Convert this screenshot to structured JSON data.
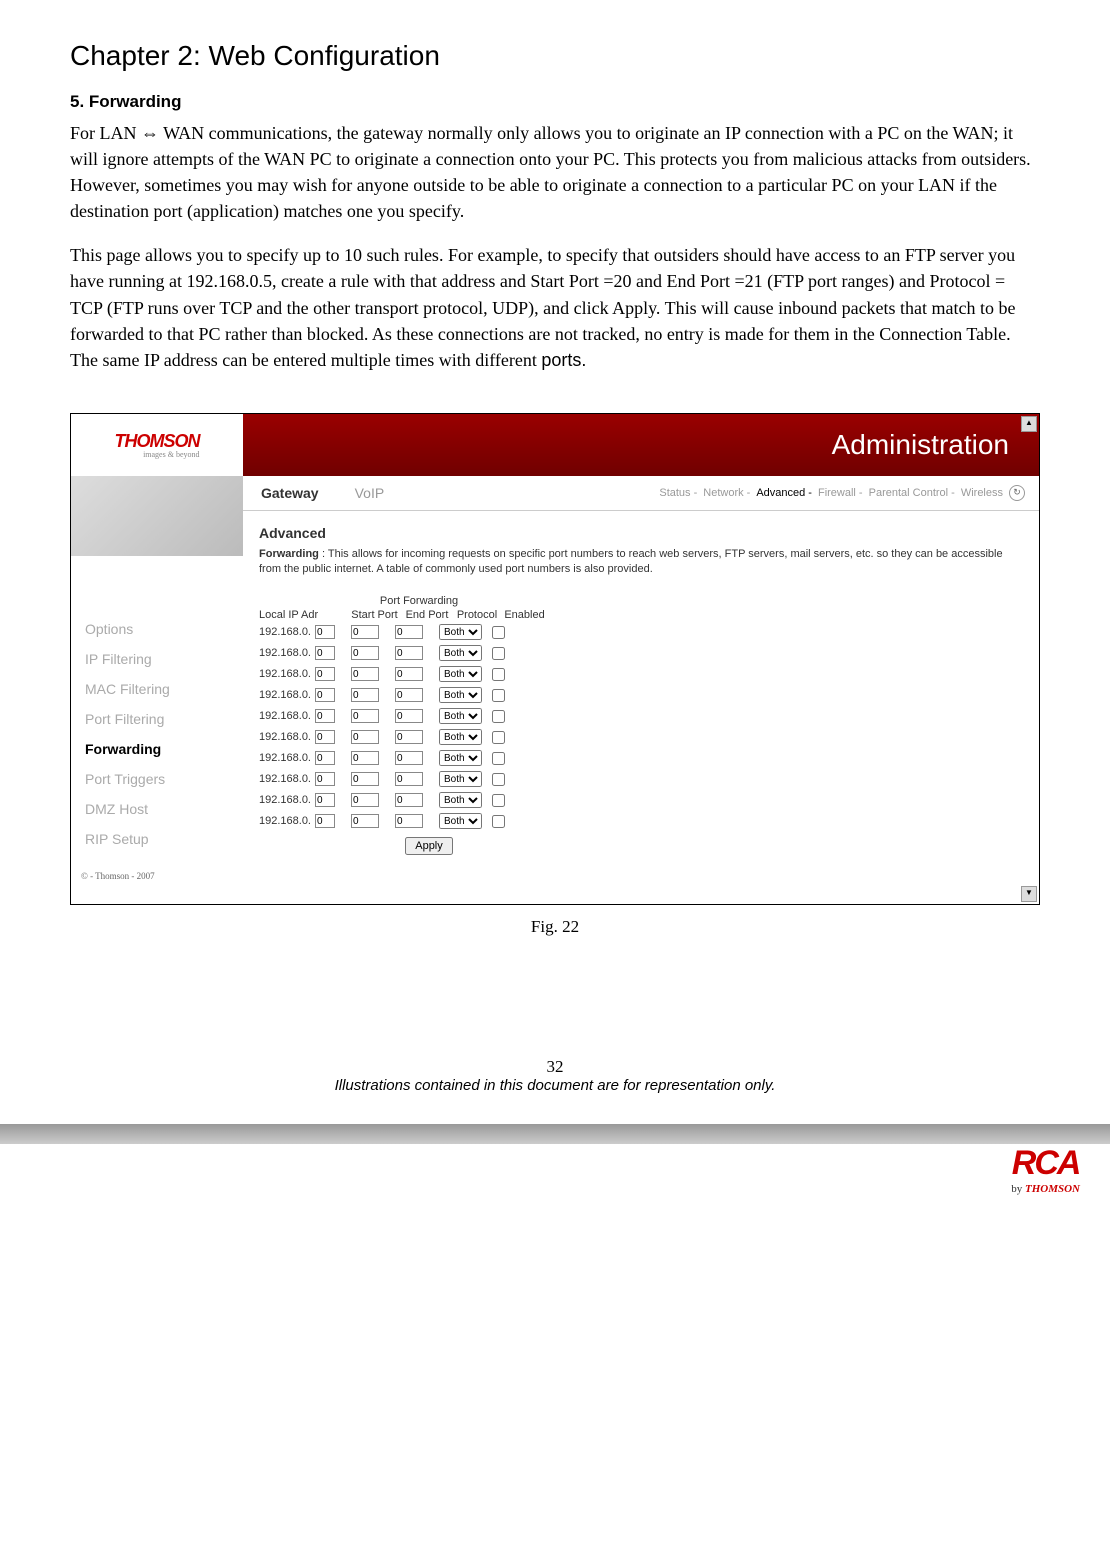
{
  "chapter_title": "Chapter 2: Web Configuration",
  "section_title": "5. Forwarding",
  "para1": "For LAN ⇔ WAN communications, the gateway normally only allows you to originate an IP connection with a PC on the WAN; it will ignore attempts of the WAN PC to originate a connection onto your PC. This protects you from malicious attacks from outsiders. However, sometimes you may wish for anyone outside to be able to originate a connection to a particular PC on your LAN if the destination port (application) matches one you specify.",
  "para2_a": "This page allows you to specify up to 10 such rules. For example, to specify that outsiders should have access to an FTP server you have running at 192.168.0.5, create a rule with that address and Start Port =20 and End Port =21 (FTP port ranges) and Protocol = TCP (FTP runs over TCP and the other transport protocol, UDP), and click Apply. This will cause inbound packets that match to be forwarded to that PC rather than blocked. As these connections are not tracked, no entry is made for them in the Connection Table. The same IP address can be entered multiple times with different ",
  "para2_b": "ports.",
  "shot": {
    "logo": "THOMSON",
    "logo_sub": "images & beyond",
    "banner": "Administration",
    "tabs": {
      "gateway": "Gateway",
      "voip": "VoIP"
    },
    "subtabs": {
      "status": "Status -",
      "network": "Network -",
      "advanced": "Advanced -",
      "firewall": "Firewall -",
      "parental": "Parental Control -",
      "wireless": "Wireless"
    },
    "sidebar": [
      "Options",
      "IP Filtering",
      "MAC Filtering",
      "Port Filtering",
      "Forwarding",
      "Port Triggers",
      "DMZ Host",
      "RIP Setup"
    ],
    "sidebar_active_index": 4,
    "panel": {
      "title": "Advanced",
      "desc_label": "Forwarding",
      "desc_text": " :  This allows for incoming requests on specific port numbers to reach web servers, FTP servers, mail servers, etc. so they can be accessible from the public internet. A table of commonly used port numbers is also provided.",
      "table_caption": "Port Forwarding",
      "headers": {
        "ip": "Local IP Adr",
        "start": "Start Port",
        "end": "End Port",
        "proto": "Protocol",
        "enabled": "Enabled"
      },
      "ip_prefix": "192.168.0.",
      "rows": [
        {
          "ip": "0",
          "start": "0",
          "end": "0",
          "proto": "Both"
        },
        {
          "ip": "0",
          "start": "0",
          "end": "0",
          "proto": "Both"
        },
        {
          "ip": "0",
          "start": "0",
          "end": "0",
          "proto": "Both"
        },
        {
          "ip": "0",
          "start": "0",
          "end": "0",
          "proto": "Both"
        },
        {
          "ip": "0",
          "start": "0",
          "end": "0",
          "proto": "Both"
        },
        {
          "ip": "0",
          "start": "0",
          "end": "0",
          "proto": "Both"
        },
        {
          "ip": "0",
          "start": "0",
          "end": "0",
          "proto": "Both"
        },
        {
          "ip": "0",
          "start": "0",
          "end": "0",
          "proto": "Both"
        },
        {
          "ip": "0",
          "start": "0",
          "end": "0",
          "proto": "Both"
        },
        {
          "ip": "0",
          "start": "0",
          "end": "0",
          "proto": "Both"
        }
      ],
      "apply": "Apply"
    },
    "copyright": "© - Thomson - 2007"
  },
  "fig_caption": "Fig. 22",
  "page_num": "32",
  "footer_note": "Illustrations contained in this document are for representation only.",
  "rca": {
    "logo": "RCA",
    "sub_pre": "by ",
    "sub_brand": "THOMSON"
  }
}
